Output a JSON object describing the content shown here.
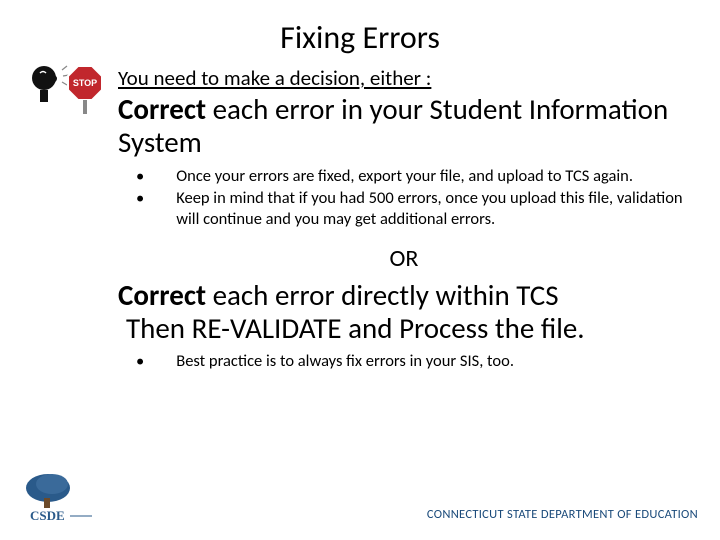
{
  "title": "Fixing Errors",
  "intro": "You need to make a decision, either :",
  "option1": {
    "bold": "Correct",
    "rest": " each error in your Student Information System",
    "bullets": [
      "Once your errors are fixed, export your file, and upload to TCS again.",
      "Keep in mind that if you had 500 errors, once you upload this file, validation will continue and you may get additional errors."
    ]
  },
  "or": "OR",
  "option2": {
    "bold": "Correct",
    "rest1": " each error directly within TCS",
    "rest2": "Then RE-VALIDATE and Process the file.",
    "bullets": [
      "Best practice is to always fix errors in your SIS, too."
    ]
  },
  "footer": {
    "org": "CONNECTICUT STATE DEPARTMENT OF EDUCATION",
    "logo_label": "CSDE"
  },
  "icons": {
    "stop": "STOP"
  }
}
